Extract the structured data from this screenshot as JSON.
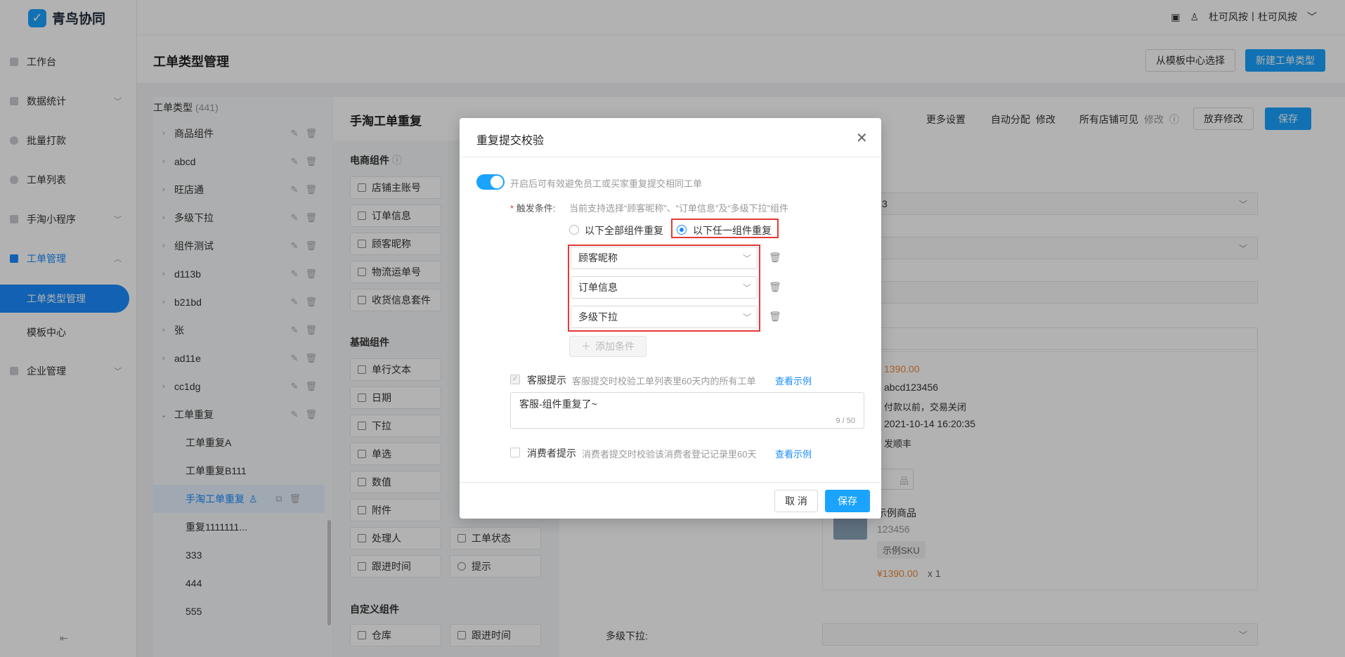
{
  "app": {
    "name": "青鸟协同"
  },
  "topbar": {
    "user_label": "杜可风按丨杜可风按"
  },
  "sidebar": {
    "items": [
      {
        "label": "工作台"
      },
      {
        "label": "数据统计"
      },
      {
        "label": "批量打款"
      },
      {
        "label": "工单列表"
      },
      {
        "label": "手淘小程序"
      },
      {
        "label": "工单管理"
      },
      {
        "label": "企业管理"
      }
    ],
    "sub_items": [
      {
        "label": "工单类型管理"
      },
      {
        "label": "模板中心"
      }
    ],
    "collapse_icon": "collapse-icon"
  },
  "page": {
    "title": "工单类型管理",
    "btn_template": "从模板中心选择",
    "btn_new": "新建工单类型"
  },
  "types": {
    "header": "工单类型",
    "count": "(441)",
    "items": [
      {
        "label": "商品组件"
      },
      {
        "label": "abcd"
      },
      {
        "label": "旺店通"
      },
      {
        "label": "多级下拉"
      },
      {
        "label": "组件测试"
      },
      {
        "label": "d113b"
      },
      {
        "label": "b21bd"
      },
      {
        "label": "张"
      },
      {
        "label": "ad11e"
      },
      {
        "label": "cc1dg"
      },
      {
        "label": "工单重复"
      }
    ],
    "children": [
      {
        "label": "工单重复A"
      },
      {
        "label": "工单重复B111"
      },
      {
        "label": "手淘工单重复"
      },
      {
        "label": "重复1111111..."
      },
      {
        "label": "333"
      },
      {
        "label": "444"
      },
      {
        "label": "555"
      }
    ]
  },
  "editor": {
    "title": "手淘工单重复",
    "more_settings": "更多设置",
    "auto_assign": "自动分配",
    "modify": "修改",
    "all_shops": "所有店铺可见",
    "modify2": "修改",
    "btn_discard": "放弃修改",
    "btn_save": "保存"
  },
  "components": {
    "ecommerce_title": "电商组件",
    "ecommerce": [
      "店铺主账号",
      "订单信息",
      "顾客昵称",
      "物流运单号",
      "收货信息套件"
    ],
    "basic_title": "基础组件",
    "basic_left": [
      "单行文本",
      "日期",
      "下拉",
      "单选",
      "数值",
      "附件",
      "处理人",
      "跟进时间"
    ],
    "basic_right": [
      "工单状态",
      "提示"
    ],
    "custom_title": "自定义组件",
    "custom": [
      "仓库",
      "跟进时间"
    ]
  },
  "preview": {
    "price": "1390.00",
    "order_id": "abcd123456",
    "order_status": "付款以前，交易关闭",
    "time": "2021-10-14 16:20:35",
    "courier": "发顺丰",
    "product_partial": "品",
    "product_name": "示例商品",
    "product_code": "123456",
    "product_sku": "示例SKU",
    "product_price": "¥1390.00",
    "product_qty": "x 1",
    "multi_label": "多级下拉:",
    "field_partial": "3"
  },
  "modal": {
    "title": "重复提交校验",
    "toggle_hint": "开启后可有效避免员工或买家重复提交相同工单",
    "trigger_label": "触发条件:",
    "trigger_hint": "当前支持选择“顾客昵称”、“订单信息”及“多级下拉”组件",
    "radio_all": "以下全部组件重复",
    "radio_any": "以下任一组件重复",
    "conditions": [
      {
        "value": "顾客昵称"
      },
      {
        "value": "订单信息"
      },
      {
        "value": "多级下拉"
      }
    ],
    "add_condition": "添加条件",
    "cs_label": "客服提示",
    "cs_hint": "客服提交时校验工单列表里60天内的所有工单",
    "cs_example": "查看示例",
    "cs_text": "客服-组件重复了~",
    "cs_count": "9 / 50",
    "consumer_label": "消费者提示",
    "consumer_hint": "消费者提交时校验该消费者登记记录里60天",
    "consumer_example": "查看示例",
    "btn_cancel": "取 消",
    "btn_save": "保存"
  },
  "colors": {
    "accent": "#1a8cff",
    "highlight": "#e53935"
  }
}
